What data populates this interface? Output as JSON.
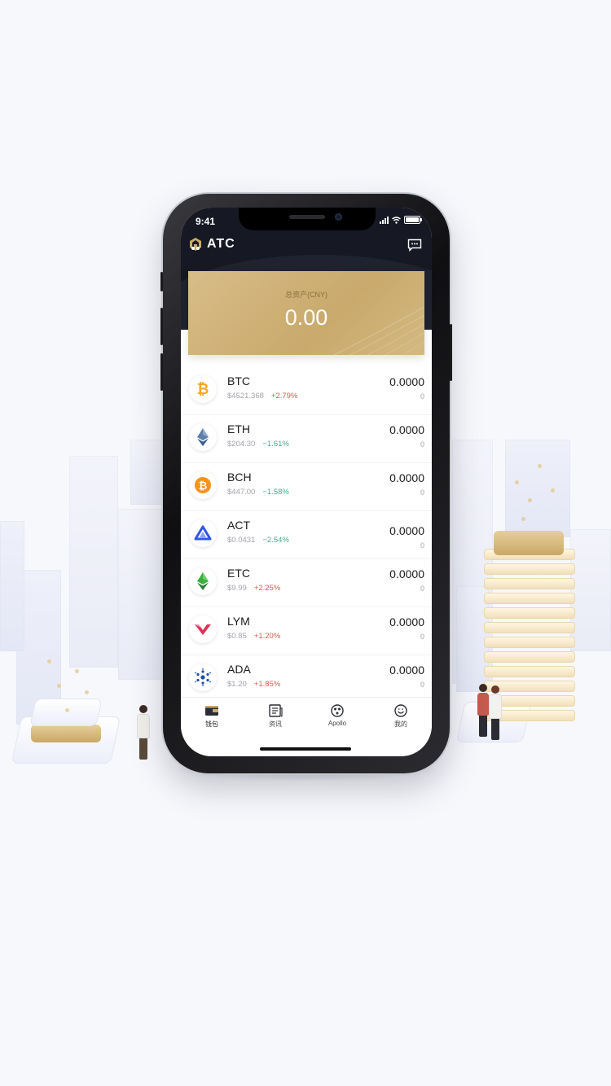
{
  "status": {
    "time": "9:41"
  },
  "header": {
    "brand": "ATC"
  },
  "asset": {
    "label": "总资产(CNY)",
    "total": "0.00"
  },
  "coins": [
    {
      "symbol": "BTC",
      "price": "$4521.368",
      "change": "+2.79%",
      "trend": "up",
      "amount": "0.0000",
      "cny": "0",
      "icon": "bitcoin-icon"
    },
    {
      "symbol": "ETH",
      "price": "$204.30",
      "change": "−1.61%",
      "trend": "down",
      "amount": "0.0000",
      "cny": "0",
      "icon": "ethereum-icon"
    },
    {
      "symbol": "BCH",
      "price": "$447.00",
      "change": "−1.58%",
      "trend": "down",
      "amount": "0.0000",
      "cny": "0",
      "icon": "bitcoin-cash-icon"
    },
    {
      "symbol": "ACT",
      "price": "$0.0431",
      "change": "−2.54%",
      "trend": "down",
      "amount": "0.0000",
      "cny": "0",
      "icon": "achain-icon"
    },
    {
      "symbol": "ETC",
      "price": "$9.99",
      "change": "+2.25%",
      "trend": "up",
      "amount": "0.0000",
      "cny": "0",
      "icon": "ethereum-classic-icon"
    },
    {
      "symbol": "LYM",
      "price": "$0.85",
      "change": "+1.20%",
      "trend": "up",
      "amount": "0.0000",
      "cny": "0",
      "icon": "lympo-icon"
    },
    {
      "symbol": "ADA",
      "price": "$1.20",
      "change": "+1.85%",
      "trend": "up",
      "amount": "0.0000",
      "cny": "0",
      "icon": "cardano-icon"
    }
  ],
  "tabs": [
    {
      "label": "钱包",
      "icon": "wallet-icon"
    },
    {
      "label": "资讯",
      "icon": "news-icon"
    },
    {
      "label": "Apollo",
      "icon": "apollo-icon"
    },
    {
      "label": "我的",
      "icon": "profile-icon"
    }
  ],
  "colors": {
    "gold": "#c9a96c",
    "header": "#161924",
    "up": "#e2584a",
    "down": "#2fb48a"
  }
}
